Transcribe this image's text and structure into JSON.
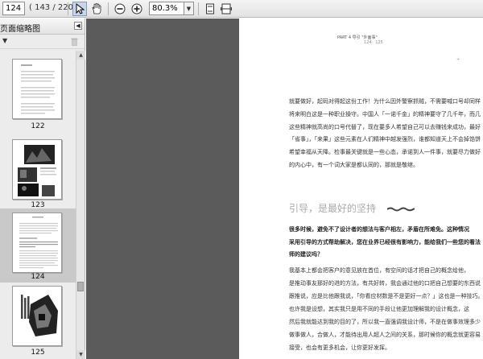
{
  "toolbar": {
    "page_value": "124",
    "page_count": "( 143 / 220 )",
    "zoom_value": "80.3%"
  },
  "panel": {
    "title": "页面缩略图",
    "options_icon": "dropdown-arrow-icon"
  },
  "thumbnails": [
    {
      "label": "122"
    },
    {
      "label": "123"
    },
    {
      "label": "124"
    },
    {
      "label": "125"
    }
  ],
  "page": {
    "header": "PART 4    导引 \"外面事\"",
    "subheader": "124 · 125",
    "para1": [
      "就要做好，起码对得起这份工作！为什么因外警察抓贼，不需要喊口号却同样",
      "将来明白这是一种职业操守。中国人「一诺千金」的精神要守了几千年，而几十年",
      "这些精神就高尚的口号代替了，现在要多人希望自己可以去赚钱来成功，最好，",
      "「省事」，「来果」这些元素在人们精神中越发强烈，谁都知道天上不会掉馅饼",
      "希望幸福从天降。检事最关键就是一些心态，承诺到人一件事，就要尽力做好。",
      "的内心中，有一个词大家是都认同的，那就是敬继。"
    ],
    "heading": "引导，是最好的坚持",
    "bold_para": [
      "很多时候，避免不了设计者的想法与客户相左，矛盾在所难免。这种情况",
      "采用引导的方式帮助解决，您在业界已经很有影响力，能给我们一些您的看法，",
      "师的建议吗？"
    ],
    "para2": [
      "    我基本上都会把客户的意见放在首位，有空间的话才把自己的概念给他，",
      "是推动事友那好的进的方法，有共好转，我会通过他的口把自己想要的东西说",
      "跟推说，应是比他跟我说，「你看应材数是不是更好一点？」这也是一种技巧。",
      "    也许我是设想，其实我只是用不同的手段让他更加理解我的设计概念，这",
      "然后我就能达到我的目的了，所以我一直强调我设计师，不是在做事效理多少",
      "做事做人，合做人，才能待出用人超人之间的关系，那时候你的概念就更容易",
      "接受，也会有更多机会，让你更好发挥。"
    ]
  }
}
